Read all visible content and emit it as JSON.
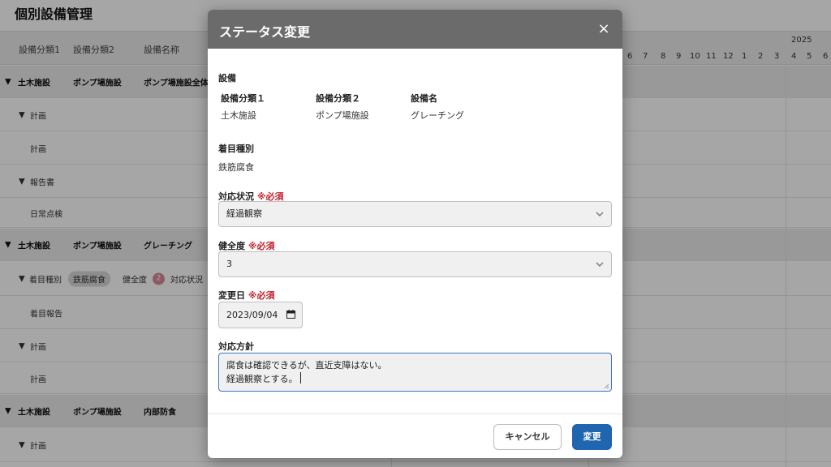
{
  "page": {
    "title": "個別設備管理"
  },
  "grid": {
    "columns": [
      "設備分類1",
      "設備分類2",
      "設備名称"
    ],
    "year": "2025",
    "months": [
      "6",
      "7",
      "8",
      "9",
      "10",
      "11",
      "12",
      "1",
      "2",
      "3",
      "4",
      "5",
      "6"
    ],
    "rows": {
      "r1": {
        "a": "土木施設",
        "b": "ポンプ場施設",
        "c": "ポンプ場施設全体"
      },
      "r2": "計画",
      "r3": "計画",
      "r4": "報告書",
      "r5": "日常点検",
      "r6": {
        "a": "土木施設",
        "b": "ポンプ場施設",
        "c": "グレーチング"
      },
      "r7": {
        "label": "着目種別",
        "pill": "鉄筋腐食",
        "health": "健全度",
        "badge": "2",
        "status": "対応状況"
      },
      "r8": "着目報告",
      "r9": "計画",
      "r10": "計画",
      "r11": {
        "a": "土木施設",
        "b": "ポンプ場施設",
        "c": "内部防食"
      },
      "r12": "計画"
    }
  },
  "modal": {
    "title": "ステータス変更",
    "close": "×",
    "equipment": {
      "label": "設備",
      "cat1_label": "設備分類１",
      "cat1_value": "土木施設",
      "cat2_label": "設備分類２",
      "cat2_value": "ポンプ場施設",
      "name_label": "設備名",
      "name_value": "グレーチング"
    },
    "focus": {
      "label": "着目種別",
      "value": "鉄筋腐食"
    },
    "status": {
      "label": "対応状況",
      "required": "※必須",
      "value": "経過観察"
    },
    "health": {
      "label": "健全度",
      "required": "※必須",
      "value": "3"
    },
    "date": {
      "label": "変更日",
      "required": "※必須",
      "value": "2023/09/04"
    },
    "policy": {
      "label": "対応方針",
      "line1": "腐食は確認できるが、直近支障はない。",
      "line2": "経過観察とする。"
    },
    "cancel": "キャンセル",
    "submit": "変更"
  }
}
